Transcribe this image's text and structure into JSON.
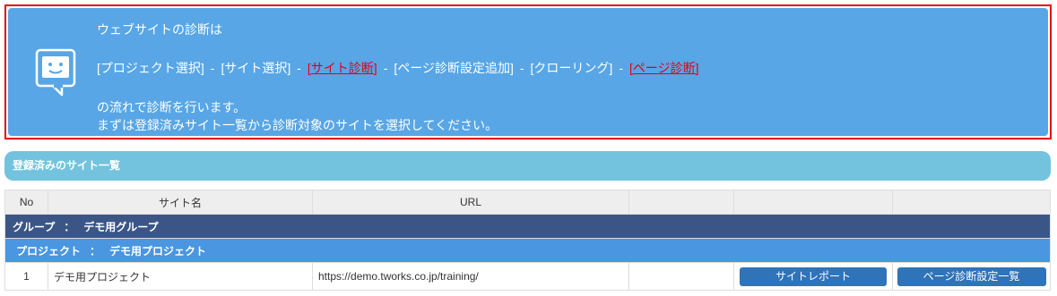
{
  "notice": {
    "line1": "ウェブサイトの診断は",
    "flow": [
      {
        "label": "[プロジェクト選択]",
        "highlight": false
      },
      {
        "label": "[サイト選択]",
        "highlight": false
      },
      {
        "label": "[サイト診断]",
        "highlight": true
      },
      {
        "label": "[ページ診断設定追加]",
        "highlight": false
      },
      {
        "label": "[クローリング]",
        "highlight": false
      },
      {
        "label": "[ページ診断]",
        "highlight": true
      }
    ],
    "separator": "-",
    "line3": "の流れで診断を行います。",
    "line4": "まずは登録済みサイト一覧から診断対象のサイトを選択してください。",
    "icon": "chat-face-icon",
    "highlight_color": "#e60012"
  },
  "section": {
    "title": "登録済みのサイト一覧"
  },
  "table": {
    "headers": {
      "no": "No",
      "site_name": "サイト名",
      "url": "URL"
    },
    "group": {
      "label": "グループ",
      "colon": "：",
      "name": "デモ用グループ"
    },
    "project": {
      "label": "プロジェクト",
      "colon": "：",
      "name": "デモ用プロジェクト"
    },
    "rows": [
      {
        "no": "1",
        "site_name": "デモ用プロジェクト",
        "url": "https://demo.tworks.co.jp/training/",
        "report_button": "サイトレポート",
        "page_settings_button": "ページ診断設定一覧"
      }
    ]
  },
  "colors": {
    "notice_bg": "#58a6e6",
    "notice_border": "#e60012",
    "section_header": "#73c3df",
    "group_row": "#3b5686",
    "project_row": "#4a96e0",
    "button": "#2f73b9"
  }
}
